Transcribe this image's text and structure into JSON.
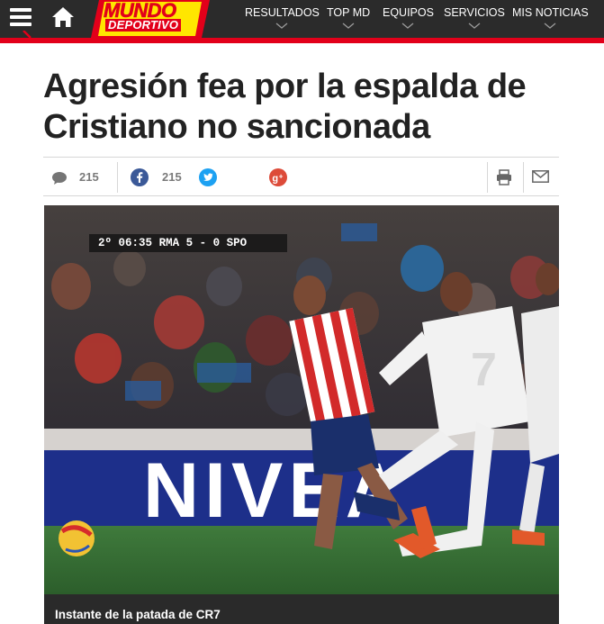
{
  "header": {
    "logo_line1": "MUNDO",
    "logo_line2": "DEPORTIVO",
    "nav": [
      "RESULTADOS",
      "TOP MD",
      "EQUIPOS",
      "SERVICIOS",
      "MIS NOTICIAS"
    ]
  },
  "article": {
    "title": "Agresión fea por la espalda de Cristiano no sancionada",
    "comments_count": "215",
    "facebook_count": "215"
  },
  "scoreboard": {
    "period": "2º",
    "clock": "06:35",
    "home": "RMA",
    "score": "5 - 0",
    "away": "SPO"
  },
  "ad_board": "NIVEA",
  "image": {
    "caption": "Instante de la patada de CR7",
    "jersey_number": "7"
  },
  "colors": {
    "brand_red": "#e2001a",
    "brand_yellow": "#ffe600",
    "topbar": "#2b2b2b",
    "facebook": "#3b5998",
    "twitter": "#1da1f2",
    "googleplus": "#dd4b39"
  }
}
